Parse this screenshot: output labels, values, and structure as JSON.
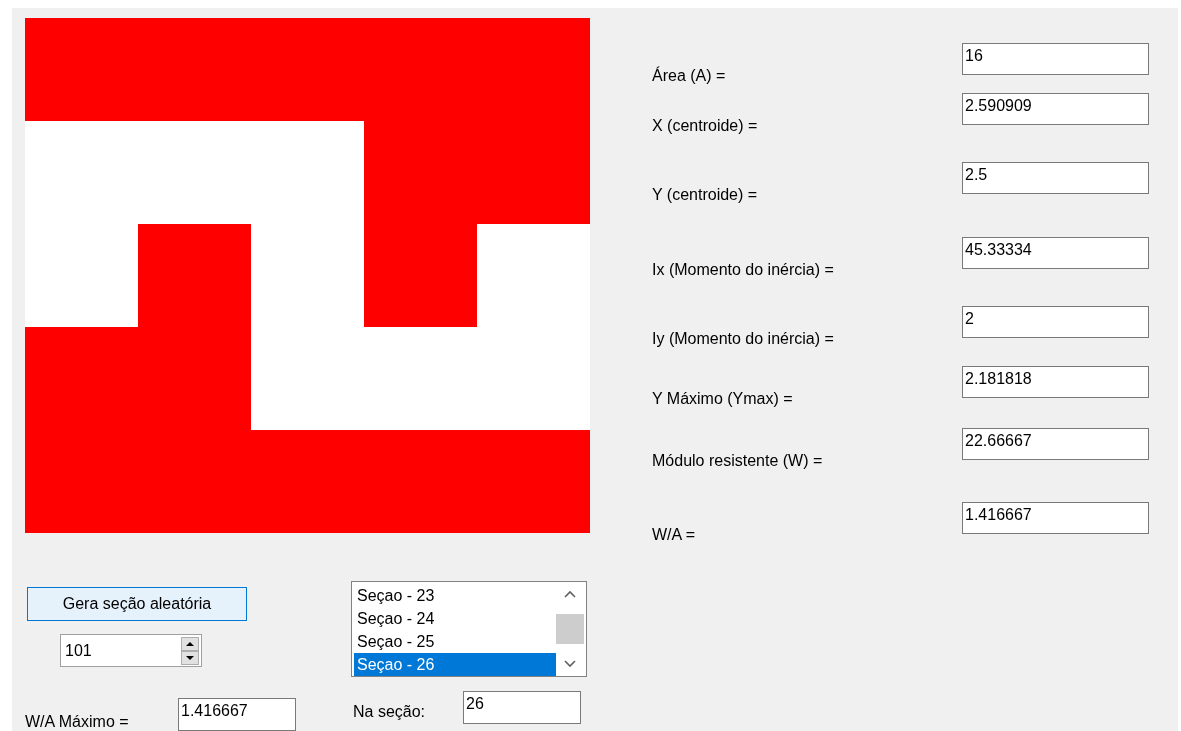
{
  "section": {
    "cells": [
      [
        true,
        true,
        true,
        true,
        true
      ],
      [
        false,
        false,
        false,
        true,
        true
      ],
      [
        false,
        true,
        false,
        true,
        false
      ],
      [
        true,
        true,
        false,
        false,
        false
      ],
      [
        true,
        true,
        true,
        true,
        true
      ]
    ]
  },
  "results": [
    {
      "label": "Área (A) =",
      "value": "16"
    },
    {
      "label": "X (centroide) =",
      "value": "2.590909"
    },
    {
      "label": "Y (centroide) =",
      "value": "2.5"
    },
    {
      "label": "Ix (Momento do inércia) =",
      "value": "45.33334"
    },
    {
      "label": "Iy (Momento do inércia) =",
      "value": "2"
    },
    {
      "label": "Y Máximo (Ymax) =",
      "value": "2.181818"
    },
    {
      "label": "Módulo resistente (W) =",
      "value": "22.66667"
    },
    {
      "label": "W/A =",
      "value": "1.416667"
    }
  ],
  "generate_button": "Gera seção aleatória",
  "count_spinner": {
    "value": "101"
  },
  "sections_list": [
    {
      "label": "Seçao - 23",
      "selected": false
    },
    {
      "label": "Seçao - 24",
      "selected": false
    },
    {
      "label": "Seçao - 25",
      "selected": false
    },
    {
      "label": "Seçao - 26",
      "selected": true
    }
  ],
  "max_ratio": {
    "label": "W/A Máximo =",
    "value": "1.416667"
  },
  "at_section": {
    "label": "Na seção:",
    "value": "26"
  }
}
